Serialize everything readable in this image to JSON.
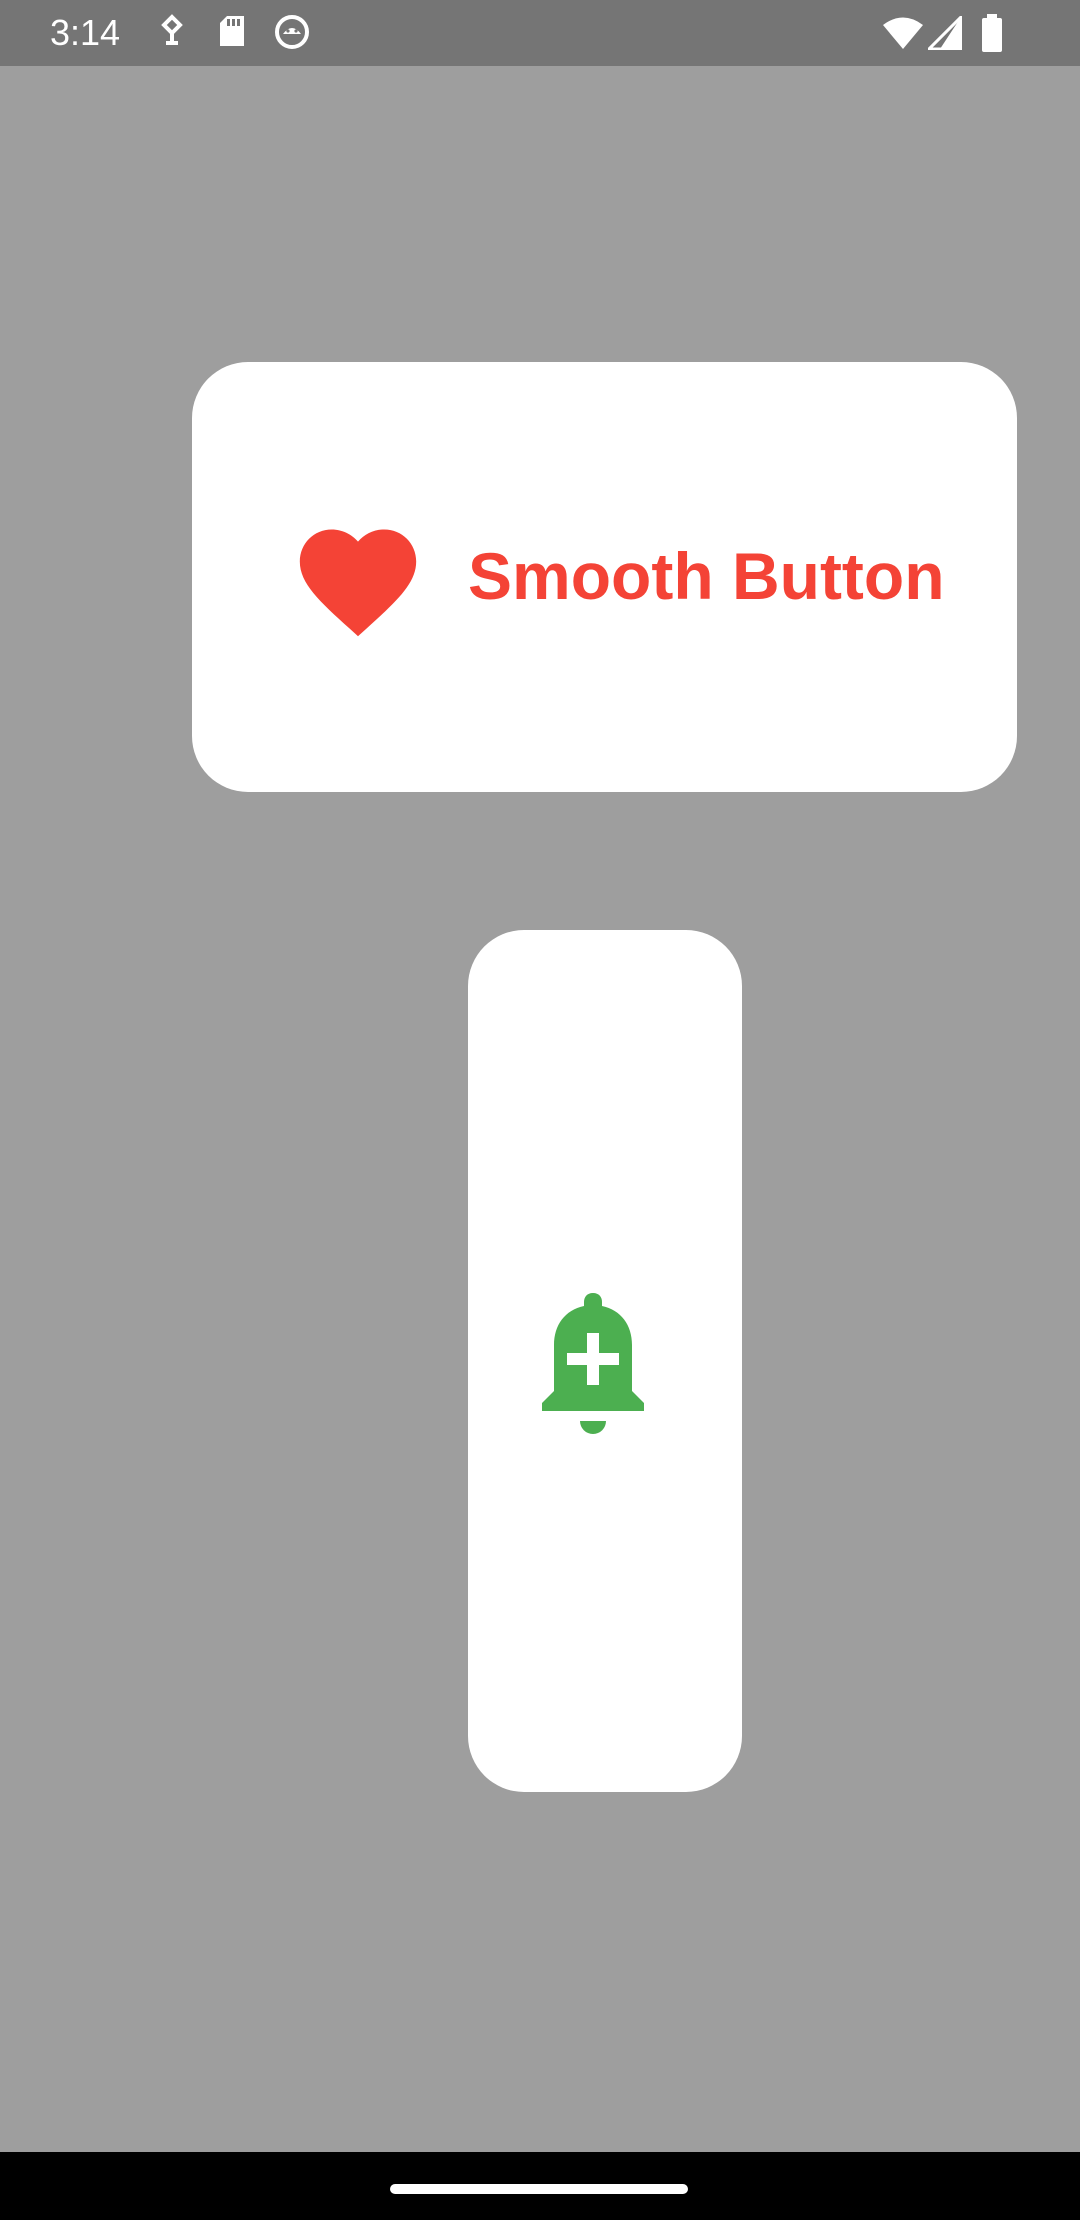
{
  "status_bar": {
    "time": "3:14",
    "left_icons": [
      "assistant-icon",
      "sd-card-icon",
      "android-debug-icon"
    ],
    "right_icons": [
      "wifi-icon",
      "cell-signal-icon",
      "battery-icon"
    ]
  },
  "main": {
    "smooth_button": {
      "label": "Smooth Button",
      "icon": "heart-icon",
      "text_color": "#f44336"
    },
    "bell_button": {
      "icon": "add-alert-bell-icon",
      "icon_color": "#4caf50"
    }
  },
  "colors": {
    "background": "#9e9e9e",
    "status_bar": "#757575",
    "button_surface": "#ffffff",
    "nav_bar": "#000000"
  }
}
